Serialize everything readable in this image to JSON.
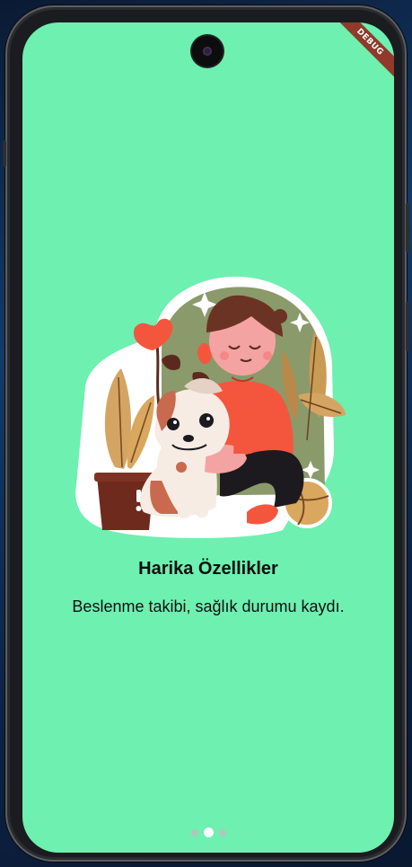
{
  "app": {
    "debug_label": "DEBUG"
  },
  "onboarding": {
    "title": "Harika Özellikler",
    "subtitle": "Beslenme takibi, sağlık durumu kaydı.",
    "illustration_icon": "boy-with-dog-illustration",
    "page_count": 3,
    "active_page": 2
  },
  "colors": {
    "background": "#6df0b0",
    "title": "#0e0e0e",
    "dot_active": "#ffffff",
    "dot_inactive": "#b3c6bd"
  }
}
